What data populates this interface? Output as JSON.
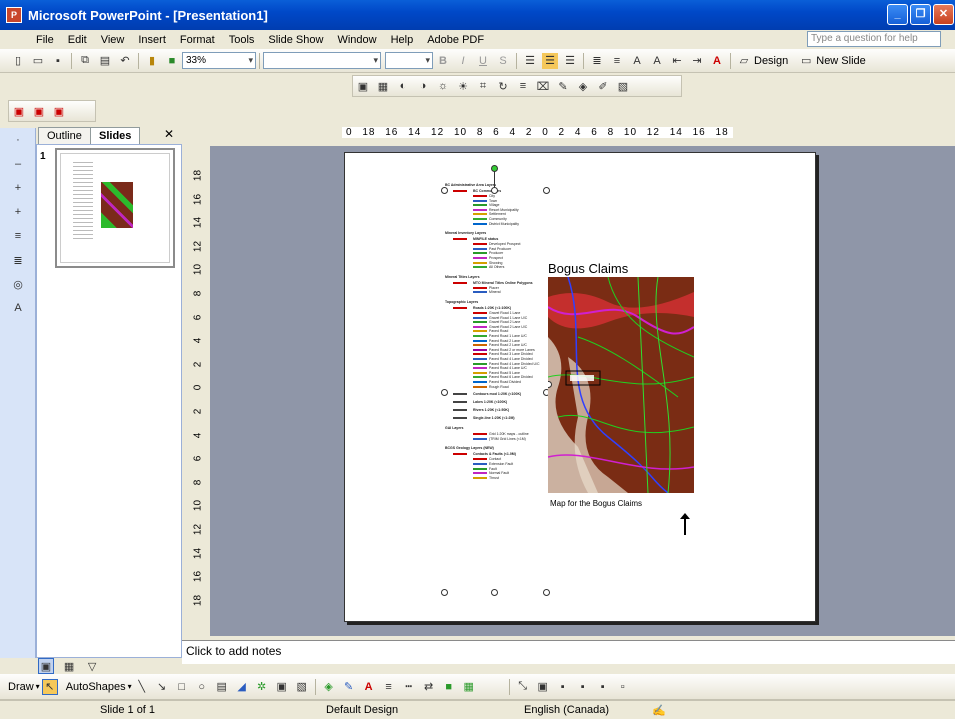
{
  "window": {
    "title": "Microsoft PowerPoint - [Presentation1]",
    "minimize": "_",
    "restore": "❐",
    "close": "✕"
  },
  "menu": {
    "items": [
      "File",
      "Edit",
      "View",
      "Insert",
      "Format",
      "Tools",
      "Slide Show",
      "Window",
      "Help",
      "Adobe PDF"
    ],
    "help_placeholder": "Type a question for help"
  },
  "standard_toolbar": {
    "zoom": "33%"
  },
  "formatting_toolbar": {
    "design_label": "Design",
    "new_slide_label": "New Slide"
  },
  "panel": {
    "tab_outline": "Outline",
    "tab_slides": "Slides",
    "close": "✕",
    "slide_number": "1"
  },
  "ruler": {
    "horizontal": "0 18 16 14 12 10 8 6 4 2 0 2 4 6 8 10 12 14 16 18",
    "vertical": [
      "18",
      "16",
      "14",
      "12",
      "10",
      "8",
      "6",
      "4",
      "2",
      "0",
      "2",
      "4",
      "6",
      "8",
      "10",
      "12",
      "14",
      "16",
      "18"
    ]
  },
  "slide": {
    "map_title": "Bogus Claims",
    "map_caption": "Map for the Bogus Claims",
    "legend": {
      "section1": "BC Administrative Area Layers",
      "section1_sub": "BC Communities",
      "section1_items": [
        "City",
        "Town",
        "Village",
        "Resort Municipality",
        "Settlement",
        "Community",
        "District Municipality"
      ],
      "section2": "Mineral Inventory Layers",
      "section2_sub": "MINFILE status",
      "section2_items": [
        "Developed Prospect",
        "Past Producer",
        "Producer",
        "Prospect",
        "Showing",
        "All Others"
      ],
      "section3": "Mineral Titles Layers",
      "section3_sub": "MTO Mineral Titles Online Polygons",
      "section3_items": [
        "Placer",
        "Mineral"
      ],
      "section4": "Topographic Layers",
      "section4_sub": "Roads 1:20K (<1:100K)",
      "section4_items": [
        "Gravel Road 1 Lane",
        "Gravel Road 1 Lane U/C",
        "Gravel Road 2 Lane",
        "Gravel Road 2 Lane U/C",
        "Paved Road",
        "Paved Road 1 Lane U/C",
        "Paved Road 2 Lane",
        "Paved Road 2 Lane U/C",
        "Paved Road 2 or more Lanes",
        "Paved Road 3 Lane Divided",
        "Paved Road 4 Lane Divided",
        "Paved Road 4 Lane Divided U/C",
        "Paved Road 4 Lane U/C",
        "Paved Road 5 Lane",
        "Paved Road 6 Lane Divided",
        "Paved Road Divided",
        "Rough Road"
      ],
      "section4_more": [
        "Contours mod 1:20K (<100K)",
        "Lakes 1:20K (<100K)",
        "Rivers 1:20K (<1:50K)",
        "Single-line 1:20K (<1:2M)"
      ],
      "section5": "GAI Layers",
      "section5_items": [
        "Grid 1:20K maps - outline",
        "(TRIM Grid Lines (<1M)"
      ],
      "section6": "BCGS Geology Layers (NEW)",
      "section6_sub": "Contacts & Faults (<1.0M)",
      "section6_items": [
        "Contact",
        "Extension Fault",
        "Fault",
        "Normal Fault",
        "Thrust"
      ]
    }
  },
  "notes": {
    "placeholder": "Click to add notes"
  },
  "drawing_toolbar": {
    "draw": "Draw",
    "autoshapes": "AutoShapes"
  },
  "status": {
    "slide": "Slide 1 of 1",
    "design": "Default Design",
    "language": "English (Canada)"
  }
}
